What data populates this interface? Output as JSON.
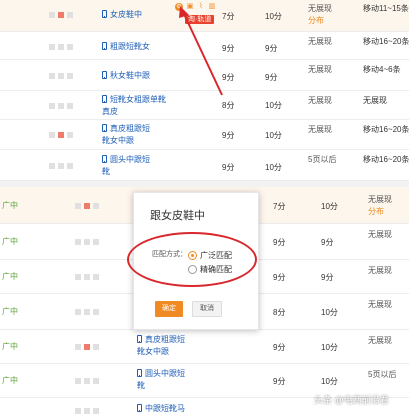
{
  "top_table": {
    "rows": [
      {
        "keyword": "女皮鞋中",
        "score": "7分",
        "score2": "10分",
        "status": "无展现",
        "status_note": "分布",
        "rank": "移动11~15条",
        "active": [
          false,
          true
        ]
      },
      {
        "keyword": "粗跟短靴女",
        "score": "9分",
        "score2": "9分",
        "status": "无展现",
        "status_note": "",
        "rank": "移动16~20条",
        "active": [
          false,
          false
        ]
      },
      {
        "keyword": "秋女鞋中跟",
        "score": "9分",
        "score2": "9分",
        "status": "无展现",
        "status_note": "",
        "rank": "移动4~6条",
        "active": [
          false,
          false
        ]
      },
      {
        "keyword_line1": "短靴女粗跟单靴",
        "keyword_line2": "真皮",
        "score": "8分",
        "score2": "10分",
        "status": "无展现",
        "status_note": "",
        "rank": "无展现",
        "active": [
          false,
          false
        ]
      },
      {
        "keyword_line1": "真皮粗跟短",
        "keyword_line2": "靴女中跟",
        "score": "9分",
        "score2": "10分",
        "status": "无展现",
        "status_note": "",
        "rank": "移动16~20条",
        "active": [
          false,
          true
        ]
      },
      {
        "keyword_line1": "圆头中跟短",
        "keyword_line2": "靴",
        "score": "9分",
        "score2": "10分",
        "status": "5页以后",
        "status_note": "",
        "rank": "移动16~20条",
        "active": [
          false,
          false
        ]
      }
    ],
    "op_icons": [
      "settings-icon",
      "copy-icon",
      "chart-icon",
      "delete-icon"
    ],
    "tag_label": "淘·轨道"
  },
  "bottom_table": {
    "rows": [
      {
        "level": "广中",
        "score": "7分",
        "score2": "10分",
        "status": "无展现",
        "status_note": "分布",
        "active": [
          false,
          true
        ]
      },
      {
        "level": "广中",
        "score": "9分",
        "score2": "9分",
        "status": "无展现",
        "status_note": "",
        "active": [
          false,
          false
        ]
      },
      {
        "level": "广中",
        "score": "9分",
        "score2": "9分",
        "status": "无展现",
        "status_note": "",
        "active": [
          false,
          false
        ]
      },
      {
        "level": "广中",
        "score": "8分",
        "score2": "10分",
        "status": "无展现",
        "status_note": "",
        "active": [
          false,
          false
        ]
      },
      {
        "level": "广中",
        "keyword_line1": "真皮粗跟短",
        "keyword_line2": "靴女中跟",
        "score": "9分",
        "score2": "10分",
        "status": "无展现",
        "status_note": "",
        "active": [
          false,
          true
        ]
      },
      {
        "level": "广中",
        "keyword_line1": "圆头中跟短",
        "keyword_line2": "靴",
        "score": "9分",
        "score2": "10分",
        "status": "5页以后",
        "status_note": "",
        "active": [
          false,
          false
        ]
      },
      {
        "level": "",
        "keyword_line1": "中跟短靴马",
        "score": "",
        "score2": "",
        "status": "",
        "status_note": "",
        "active": [
          false,
          false
        ]
      }
    ]
  },
  "dialog": {
    "title": "跟女皮鞋中",
    "match_label": "匹配方式：",
    "options": [
      "广泛匹配",
      "精确匹配"
    ],
    "selected": 0,
    "ok_label": "确定",
    "cancel_label": "取消"
  },
  "watermark": "头条 @电商前沿君",
  "colors": {
    "accent": "#ef8b22",
    "keyword_blue": "#1f5fb8",
    "annotation_red": "#d9282c",
    "level_green": "#5fa43a"
  }
}
